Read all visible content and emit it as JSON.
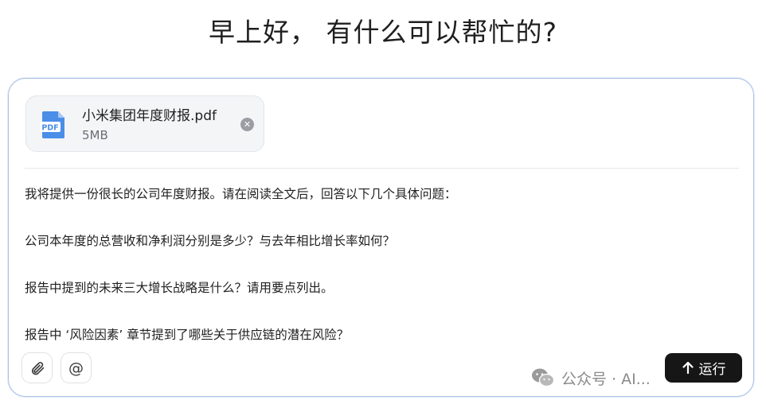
{
  "greeting": "早上好， 有什么可以帮忙的?",
  "attachment": {
    "file_name": "小米集团年度财报.pdf",
    "file_size": "5MB",
    "icon": "pdf-file-icon",
    "icon_label": "PDF",
    "remove_icon": "close-circle-icon"
  },
  "prompt": {
    "lines": [
      "我将提供一份很长的公司年度财报。请在阅读全文后，回答以下几个具体问题：",
      "公司本年度的总营收和净利润分别是多少？与去年相比增长率如何？",
      "报告中提到的未来三大增长战略是什么？请用要点列出。",
      "报告中 ‘风险因素’ 章节提到了哪些关于供应链的潜在风险？"
    ]
  },
  "toolbar": {
    "attach_icon": "paperclip-icon",
    "mention_icon": "at-sign-icon",
    "mention_glyph": "@",
    "run_label": "运行",
    "run_icon": "arrow-up-icon"
  },
  "watermark": {
    "icon": "wechat-icon",
    "text": "公众号 · AI..."
  },
  "colors": {
    "composer_border": "#a9c2e4",
    "pdf_icon": "#4a8ee8",
    "run_button": "#161616"
  }
}
